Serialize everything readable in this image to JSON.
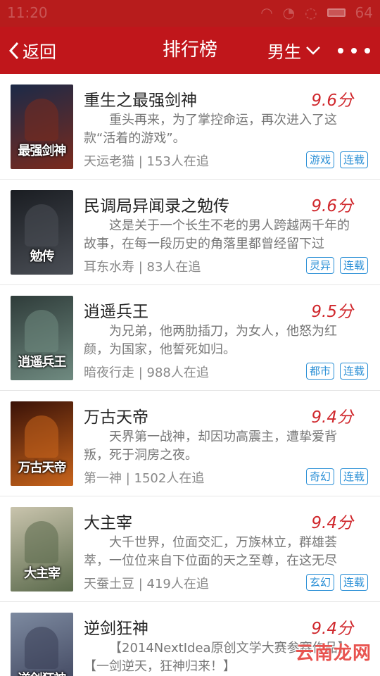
{
  "status": {
    "time": "11:20",
    "battery": "64"
  },
  "header": {
    "back_label": "返回",
    "title": "排行榜",
    "gender_label": "男生"
  },
  "books": [
    {
      "title": "重生之最强剑神",
      "score": "9.6分",
      "desc": "重头再来，为了掌控命运，再次进入了这款“活着的游戏”。",
      "author": "天运老猫",
      "readers": "153人在追",
      "category": "游戏",
      "status": "连载",
      "cover_text": "最强剑神",
      "cover_colors": [
        "#1b2a48",
        "#7a2a1d"
      ]
    },
    {
      "title": "民调局异闻录之勉传",
      "score": "9.6分",
      "desc": "这是关于一个长生不老的男人跨越两千年的故事，在每一段历史的角落里都曾经留下过",
      "author": "耳东水寿",
      "readers": "83人在追",
      "category": "灵异",
      "status": "连载",
      "cover_text": "勉传",
      "cover_colors": [
        "#1a1d22",
        "#4a4e55"
      ]
    },
    {
      "title": "逍遥兵王",
      "score": "9.5分",
      "desc": "为兄弟，他两肋插刀，为女人，他怒为红颜，为国家，他誓死如归。",
      "author": "暗夜行走",
      "readers": "988人在追",
      "category": "都市",
      "status": "连载",
      "cover_text": "逍遥兵王",
      "cover_colors": [
        "#2f3c3a",
        "#6f8a80"
      ]
    },
    {
      "title": "万古天帝",
      "score": "9.4分",
      "desc": "天界第一战神，却因功高震主，遭挚爱背叛，死于洞房之夜。",
      "author": "第一神",
      "readers": "1502人在追",
      "category": "奇幻",
      "status": "连载",
      "cover_text": "万古天帝",
      "cover_colors": [
        "#3a1208",
        "#c8641b"
      ]
    },
    {
      "title": "大主宰",
      "score": "9.4分",
      "desc": "大千世界，位面交汇，万族林立，群雄荟萃，一位位来自下位面的天之至尊，在这无尽",
      "author": "天蚕土豆",
      "readers": "419人在追",
      "category": "玄幻",
      "status": "连载",
      "cover_text": "大主宰",
      "cover_colors": [
        "#c9c4ad",
        "#5b6a4c"
      ]
    },
    {
      "title": "逆剑狂神",
      "score": "9.4分",
      "desc": "【2014NextIdea原创文学大赛参赛作品】【一剑逆天，狂神归来！】",
      "author": "",
      "readers": "",
      "category": "",
      "status": "",
      "cover_text": "逆剑狂神",
      "cover_colors": [
        "#7d8aa0",
        "#3a3f58"
      ]
    }
  ],
  "watermark": "云南龙网",
  "colors": {
    "header": "#c0161b",
    "score": "#d0282d",
    "tag": "#2a8fd6"
  }
}
